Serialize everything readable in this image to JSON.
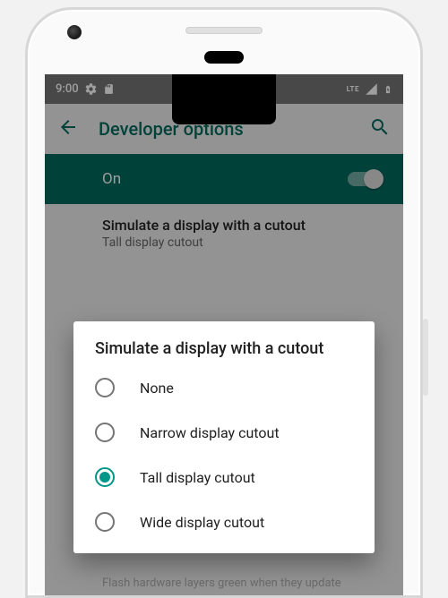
{
  "statusbar": {
    "time": "9:00",
    "lte_label": "LTE"
  },
  "appbar": {
    "title": "Developer options"
  },
  "master_toggle": {
    "label": "On",
    "enabled": true
  },
  "visible_setting": {
    "title": "Simulate a display with a cutout",
    "summary": "Tall display cutout"
  },
  "dialog": {
    "title": "Simulate a display with a cutout",
    "options": [
      {
        "label": "None",
        "selected": false
      },
      {
        "label": "Narrow display cutout",
        "selected": false
      },
      {
        "label": "Tall display cutout",
        "selected": true
      },
      {
        "label": "Wide display cutout",
        "selected": false
      }
    ]
  },
  "leak_text": "Flash hardware layers green when they update",
  "colors": {
    "teal_primary": "#00695c",
    "teal_accent": "#009688",
    "status_bg": "#757575"
  }
}
